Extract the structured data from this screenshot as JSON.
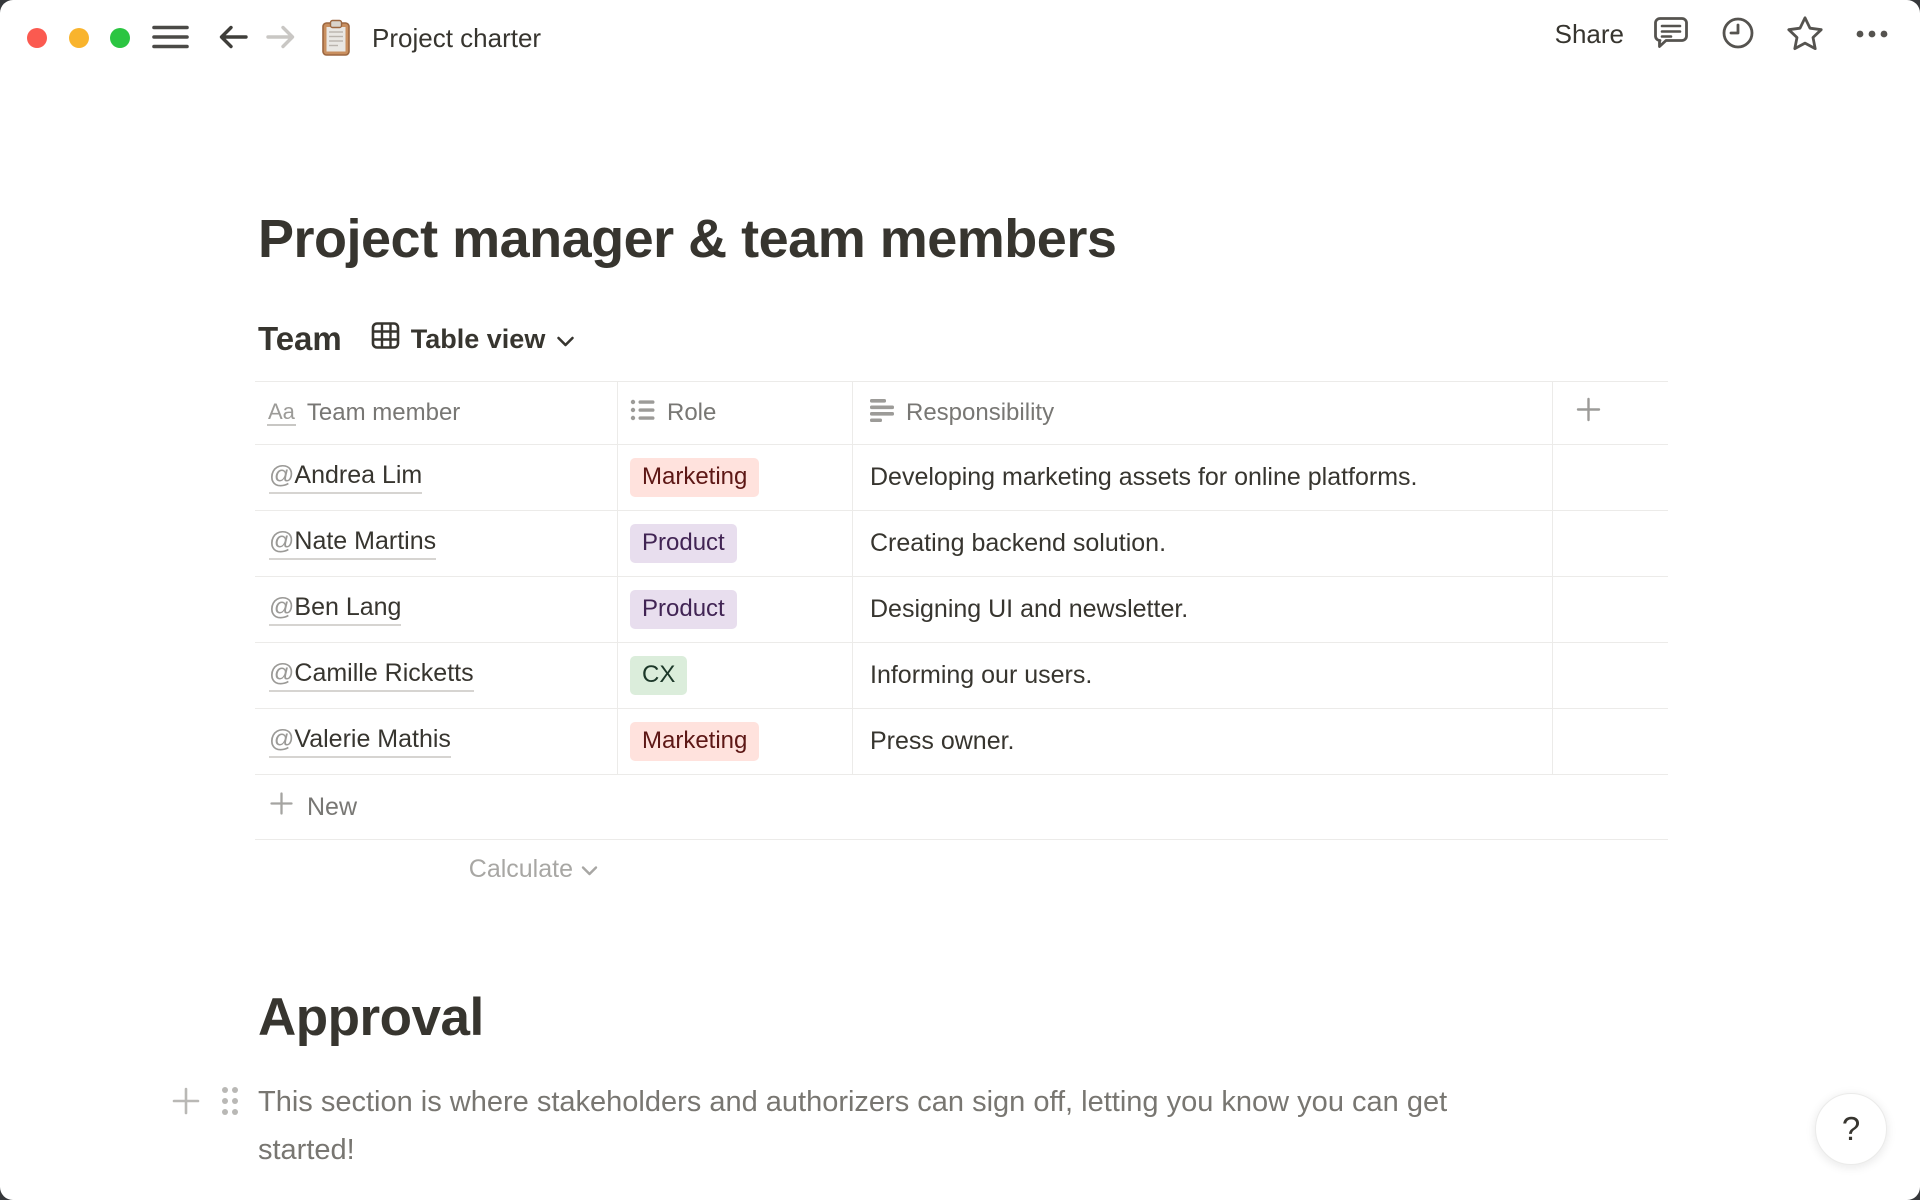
{
  "colors": {
    "outside_bg": "#36383B",
    "page_bg": "#FFFFFF",
    "text_primary": "#37352F",
    "text_secondary": "#787774",
    "text_faint": "#A8A7A4",
    "border": "#ECEBE9",
    "traffic_red": "#FB5A50",
    "traffic_yellow": "#F9B42D",
    "traffic_green": "#2BC541"
  },
  "badge_colors": {
    "red": {
      "bg": "#FFE2DD",
      "text": "#5D1715"
    },
    "purple": {
      "bg": "#E8DEEE",
      "text": "#412454"
    },
    "green": {
      "bg": "#DBEDDB",
      "text": "#1C3829"
    }
  },
  "topbar": {
    "window_controls": [
      "close",
      "minimize",
      "zoom"
    ],
    "menu_icon": "hamburger-menu-icon",
    "back_icon": "arrow-left-icon",
    "forward_icon": "arrow-right-icon",
    "page_icon": "clipboard-icon",
    "title": "Project charter",
    "share_label": "Share",
    "comments_icon": "comment-bubble-icon",
    "updates_icon": "clock-icon",
    "favorite_icon": "star-icon",
    "more_icon": "ellipsis-icon"
  },
  "page": {
    "title": "Project manager & team members"
  },
  "team": {
    "heading": "Team",
    "view_icon": "table-grid-icon",
    "view_label": "Table view",
    "view_chevron": "chevron-down-icon"
  },
  "table": {
    "columns": [
      {
        "icon": "text-aa-icon",
        "label": "Team member"
      },
      {
        "icon": "select-list-icon",
        "label": "Role"
      },
      {
        "icon": "text-lines-icon",
        "label": "Responsibility"
      }
    ],
    "add_column_icon": "plus-icon",
    "rows": [
      {
        "at": "@",
        "member": "Andrea Lim",
        "role": "Marketing",
        "role_color": "red",
        "responsibility": "Developing marketing assets for online platforms."
      },
      {
        "at": "@",
        "member": "Nate Martins",
        "role": "Product",
        "role_color": "purple",
        "responsibility": "Creating backend solution."
      },
      {
        "at": "@",
        "member": "Ben Lang",
        "role": "Product",
        "role_color": "purple",
        "responsibility": "Designing UI and newsletter."
      },
      {
        "at": "@",
        "member": "Camille Ricketts",
        "role": "CX",
        "role_color": "green",
        "responsibility": "Informing our users."
      },
      {
        "at": "@",
        "member": "Valerie Mathis",
        "role": "Marketing",
        "role_color": "red",
        "responsibility": "Press owner."
      }
    ],
    "new_label": "New",
    "calculate_label": "Calculate"
  },
  "approval": {
    "heading": "Approval",
    "paragraph_line1": "This section is where stakeholders and authorizers can sign off, letting you know you can get",
    "paragraph_line2": "started!",
    "add_block_icon": "plus-icon",
    "drag_handle_icon": "drag-handle-icon"
  },
  "help": {
    "label": "?"
  }
}
